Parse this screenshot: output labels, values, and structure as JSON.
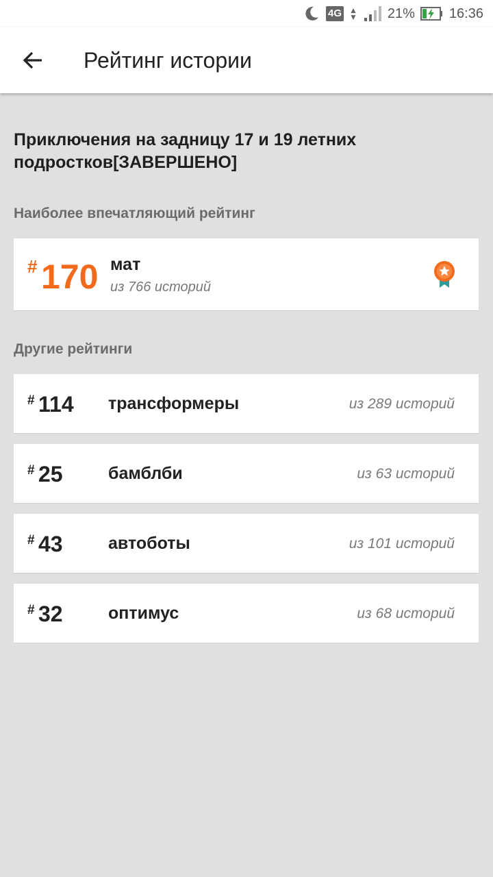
{
  "status_bar": {
    "network": "4G",
    "battery": "21%",
    "time": "16:36"
  },
  "app_bar": {
    "title": "Рейтинг истории"
  },
  "story": {
    "title": "Приключения на задницу 17 и 19 летних подростков[ЗАВЕРШЕНО]"
  },
  "top_ranking": {
    "section_label": "Наиболее впечатляющий рейтинг",
    "hash": "#",
    "rank": "170",
    "tag": "мат",
    "count": "из 766 историй",
    "icon": "medal-icon"
  },
  "other_rankings": {
    "section_label": "Другие рейтинги",
    "items": [
      {
        "hash": "#",
        "rank": "114",
        "tag": "трансформеры",
        "count": "из 289 историй"
      },
      {
        "hash": "#",
        "rank": "25",
        "tag": "бамблби",
        "count": "из 63 историй"
      },
      {
        "hash": "#",
        "rank": "43",
        "tag": "автоботы",
        "count": "из 101 историй"
      },
      {
        "hash": "#",
        "rank": "32",
        "tag": "оптимус",
        "count": "из 68 историй"
      }
    ]
  },
  "colors": {
    "accent": "#f26a1b",
    "background": "#e0dfe1",
    "card": "#ffffff"
  }
}
